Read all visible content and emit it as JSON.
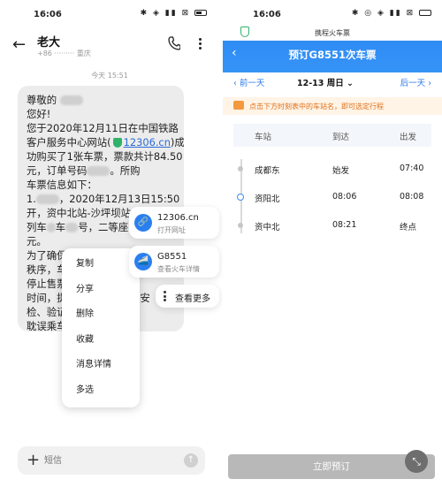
{
  "left": {
    "status": {
      "time": "16:06",
      "icons": "✱ ◈ ▮▮ ⊠"
    },
    "header": {
      "back": "←",
      "contact_name": "老大",
      "contact_sub": "+86 ········· 重庆"
    },
    "date_separator": "今天 15:51",
    "message": {
      "lines": [
        "尊敬的",
        "您好!",
        "您于2020年12月11日在中国铁路",
        "客户服务中心网站(",
        "功购买了1张车票，票款共计84.50",
        "元，订单号码",
        "车票信息如下：",
        "1.",
        "开，资中北站-沙坪坝站，G8551次",
        "列车",
        "元。",
        "为了确保旅客人身安全和列车运行",
        "秩序，车",
        "停止售票",
        "时间，提",
        "检、验证",
        "耽误乘车"
      ],
      "link": "12306.cn",
      "segments": {
        "l4_suffix": ")成",
        "l6_suffix": "。所购",
        "l8_mid": "，2020年12月13日15:50",
        "l10_mid": "车",
        "l10_mid2": "号，二等座，",
        "l15_suffix": "票、安",
        "l16_suffix": "，以"
      }
    },
    "context_menu": [
      "复制",
      "分享",
      "删除",
      "收藏",
      "消息详情",
      "多选"
    ],
    "cards": {
      "url": {
        "icon": "🔗",
        "title": "12306.cn",
        "sub": "打开网址"
      },
      "train": {
        "icon": "🚄",
        "title": "G8551",
        "sub": "查看火车详情"
      },
      "more": {
        "label": "查看更多"
      }
    },
    "compose": {
      "plus": "+",
      "placeholder": "短信",
      "send": "↑"
    }
  },
  "right": {
    "status": {
      "time": "16:06",
      "icons": "✱ ◎ ◈ ▮▮ ⊠"
    },
    "mini_app_title": "携程火车票",
    "header": {
      "back": "‹",
      "title": "预订G8551次车票"
    },
    "date_bar": {
      "prev": "‹ 前一天",
      "current": "12-13 周日 ⌄",
      "next": "后一天 ›"
    },
    "tip": "点击下方时刻表中的车站名，即可选定行程",
    "table_headers": {
      "station": "车站",
      "arrive": "到达",
      "depart": "出发"
    },
    "stops": [
      {
        "station": "成都东",
        "arrive": "始发",
        "depart": "07:40",
        "highlight": false
      },
      {
        "station": "资阳北",
        "arrive": "08:06",
        "depart": "08:08",
        "highlight": true
      },
      {
        "station": "资中北",
        "arrive": "08:21",
        "depart": "终点",
        "highlight": false
      }
    ],
    "book_button": "立即预订",
    "float_button": "⤡"
  }
}
